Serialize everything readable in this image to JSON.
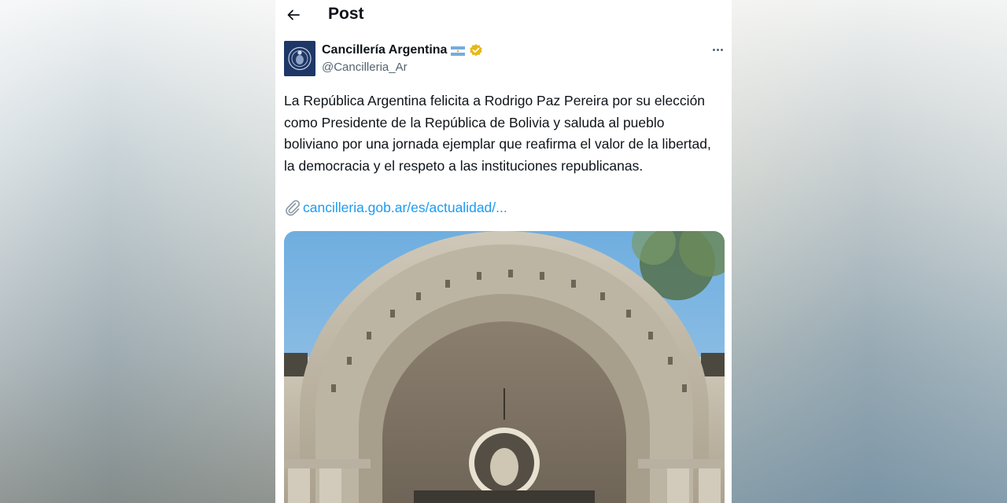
{
  "header": {
    "title": "Post"
  },
  "author": {
    "display_name": "Cancillería Argentina",
    "handle": "@Cancilleria_Ar"
  },
  "tweet": {
    "text": "La República Argentina felicita a Rodrigo Paz Pereira por su elección como Presidente de la República de Bolivia y saluda al pueblo boliviano por una jornada ejemplar que reafirma el valor de la libertad, la democracia y el respeto a las instituciones republicanas.",
    "link": "cancilleria.gob.ar/es/actualidad/..."
  },
  "icons": {
    "back": "arrow-left-icon",
    "flag": "argentina-flag-icon",
    "verified": "verified-badge-icon",
    "more": "more-options-icon",
    "link": "paperclip-icon"
  },
  "colors": {
    "accent": "#1d9bf0",
    "verified": "#e8b816",
    "text": "#0f1419",
    "secondary": "#536471"
  }
}
